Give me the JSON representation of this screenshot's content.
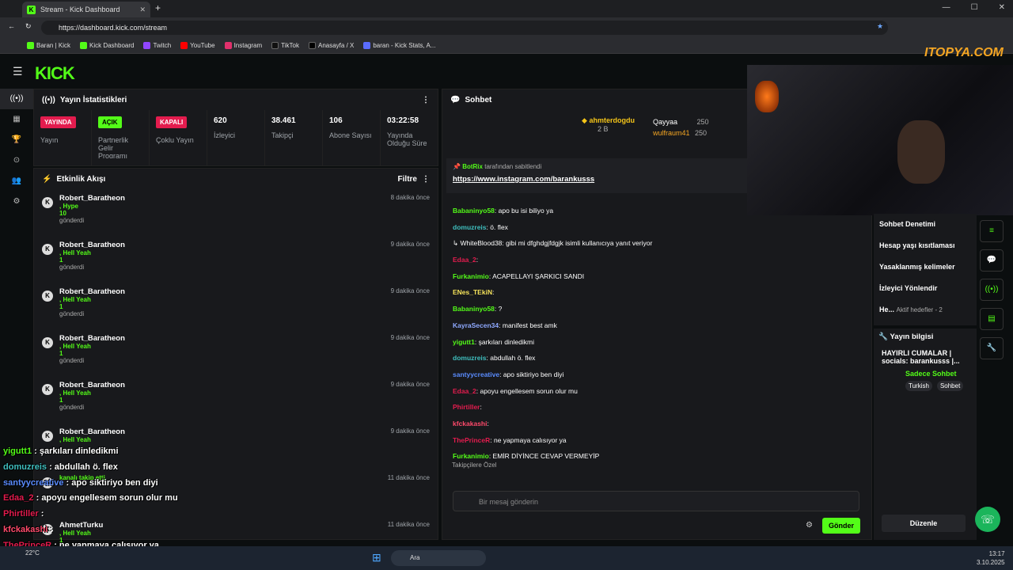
{
  "browser": {
    "tab_title": "Stream - Kick Dashboard",
    "url": "https://dashboard.kick.com/stream",
    "bookmarks": [
      "Baran | Kick",
      "Kick Dashboard",
      "Twitch",
      "YouTube",
      "Instagram",
      "TikTok",
      "Anasayfa / X",
      "baran - Kick Stats, A..."
    ]
  },
  "logo": "KICK",
  "stats": {
    "title": "Yayın İstatistikleri",
    "items": [
      {
        "badge": "YAYINDA",
        "label": "Yayın"
      },
      {
        "badge": "AÇIK",
        "label": "Partnerlik Gelir Programı"
      },
      {
        "badge": "KAPALI",
        "label": "Çoklu Yayın"
      },
      {
        "value": "620",
        "label": "İzleyici"
      },
      {
        "value": "38.461",
        "label": "Takipçi"
      },
      {
        "value": "106",
        "label": "Abone Sayısı"
      },
      {
        "value": "03:22:58",
        "label": "Yayında Olduğu Süre"
      }
    ]
  },
  "activity": {
    "title": "Etkinlik Akışı",
    "filter": "Filtre",
    "items": [
      {
        "name": "Robert_Baratheon",
        "gift": ", Hype",
        "amount": "10",
        "action": "gönderdi",
        "time": "8 dakika önce"
      },
      {
        "name": "Robert_Baratheon",
        "gift": ", Hell Yeah",
        "amount": "1",
        "action": "gönderdi",
        "time": "9 dakika önce"
      },
      {
        "name": "Robert_Baratheon",
        "gift": ", Hell Yeah",
        "amount": "1",
        "action": "gönderdi",
        "time": "9 dakika önce"
      },
      {
        "name": "Robert_Baratheon",
        "gift": ", Hell Yeah",
        "amount": "1",
        "action": "gönderdi",
        "time": "9 dakika önce"
      },
      {
        "name": "Robert_Baratheon",
        "gift": ", Hell Yeah",
        "amount": "1",
        "action": "gönderdi",
        "time": "9 dakika önce"
      },
      {
        "name": "Robert_Baratheon",
        "gift": ", Hell Yeah",
        "amount": "",
        "action": "",
        "time": "9 dakika önce"
      },
      {
        "name": "",
        "gift": "kanalı takip etti",
        "amount": "",
        "action": "",
        "time": "11 dakika önce"
      },
      {
        "name": "AhmetTurku",
        "gift": ", Hell Yeah",
        "amount": "1",
        "action": "",
        "time": "11 dakika önce"
      }
    ]
  },
  "chat": {
    "title": "Sohbet",
    "top": [
      {
        "name": "ahmterdogdu",
        "value": "2 B"
      },
      {
        "name": "Qayyaa",
        "value": "250"
      },
      {
        "name": "wulfraum41",
        "value": "250"
      }
    ],
    "pinned_by": "BotRix",
    "pinned_text": "tarafından sabitlendi",
    "pinned_link": "https://www.instagram.com/barankusss",
    "messages": [
      {
        "user": "Babaninyo58",
        "color": "#53fc18",
        "text": "apo bu isi biliyo ya"
      },
      {
        "user": "domuzreis",
        "color": "#3fbfbf",
        "text": "ö. flex"
      },
      {
        "user": "",
        "color": "#888",
        "text": "↳ WhiteBlood38: gibi mi dfghdgjfdgjk isimli kullanıcıya yanıt veriyor"
      },
      {
        "user": "Edaa_2",
        "color": "#e31c4e",
        "text": ""
      },
      {
        "user": "Furkanimio",
        "color": "#53fc18",
        "text": "ACAPELLAYI ŞARKICI SANDI"
      },
      {
        "user": "ENes_TEkiN",
        "color": "#f5e25a",
        "text": ""
      },
      {
        "user": "Babaninyo58",
        "color": "#53fc18",
        "text": "?"
      },
      {
        "user": "KayraSecen34",
        "color": "#8fa9ff",
        "text": "manifest best amk"
      },
      {
        "user": "yigutt1",
        "color": "#53fc18",
        "text": "şarkıları dinledikmi"
      },
      {
        "user": "domuzreis",
        "color": "#3fbfbf",
        "text": "abdullah ö. flex"
      },
      {
        "user": "santyycreative",
        "color": "#5a8cff",
        "text": "apo siktiriyo ben diyi"
      },
      {
        "user": "Edaa_2",
        "color": "#e31c4e",
        "text": "apoyu engellesem sorun olur mu"
      },
      {
        "user": "Phirtiller",
        "color": "#e31c4e",
        "text": ""
      },
      {
        "user": "kfckakashi",
        "color": "#ff4a6b",
        "text": ""
      },
      {
        "user": "ThePrinceR",
        "color": "#e31c4e",
        "text": "ne yapmaya calısıyor ya"
      },
      {
        "user": "Furkanimio",
        "color": "#53fc18",
        "text": "EMİR DİYİNCE CEVAP VERMEYİP"
      }
    ],
    "followers_only": "Takipçilere Özel",
    "placeholder": "Bir mesaj gönderin",
    "send": "Gönder"
  },
  "right": {
    "items": [
      "Sohbet Denetimi",
      "Hesap yaşı kısıtlaması",
      "Yasaklanmış kelimeler",
      "İzleyici Yönlendir",
      "He...",
      "Aktif hedefler - 2"
    ],
    "info_title": "Yayın bilgisi",
    "stream_title": "HAYIRLI CUMALAR | socials: barankusss |...",
    "category": "Sadece Sohbet",
    "tags": [
      "Turkish",
      "Sohbet"
    ],
    "edit": "Düzenle"
  },
  "overlay": [
    {
      "user": "yigutt1",
      "color": "#53fc18",
      "text": ": şarkıları dinledikmi"
    },
    {
      "user": "domuzreis",
      "color": "#3fbfbf",
      "text": ": abdullah ö. flex"
    },
    {
      "user": "santyycreative",
      "color": "#5a8cff",
      "text": ": apo siktiriyo ben diyi"
    },
    {
      "user": "Edaa_2",
      "color": "#e31c4e",
      "text": ": apoyu engellesem sorun olur mu"
    },
    {
      "user": "Phirtiller",
      "color": "#e31c4e",
      "text": ":"
    },
    {
      "user": "kfckakashi",
      "color": "#ff4a6b",
      "text": ":"
    },
    {
      "user": "ThePrinceR",
      "color": "#e31c4e",
      "text": ": ne yapmaya calısıyor ya"
    },
    {
      "user": "Furkanimio",
      "color": "#53fc18",
      "text": ": EMİR DİYİNCE CEVAP VERMEYİP"
    }
  ],
  "taskbar": {
    "weather": "22°C",
    "search": "Ara",
    "time": "13:17",
    "date": "3.10.2025"
  },
  "watermark": "ITOPYA.COM"
}
